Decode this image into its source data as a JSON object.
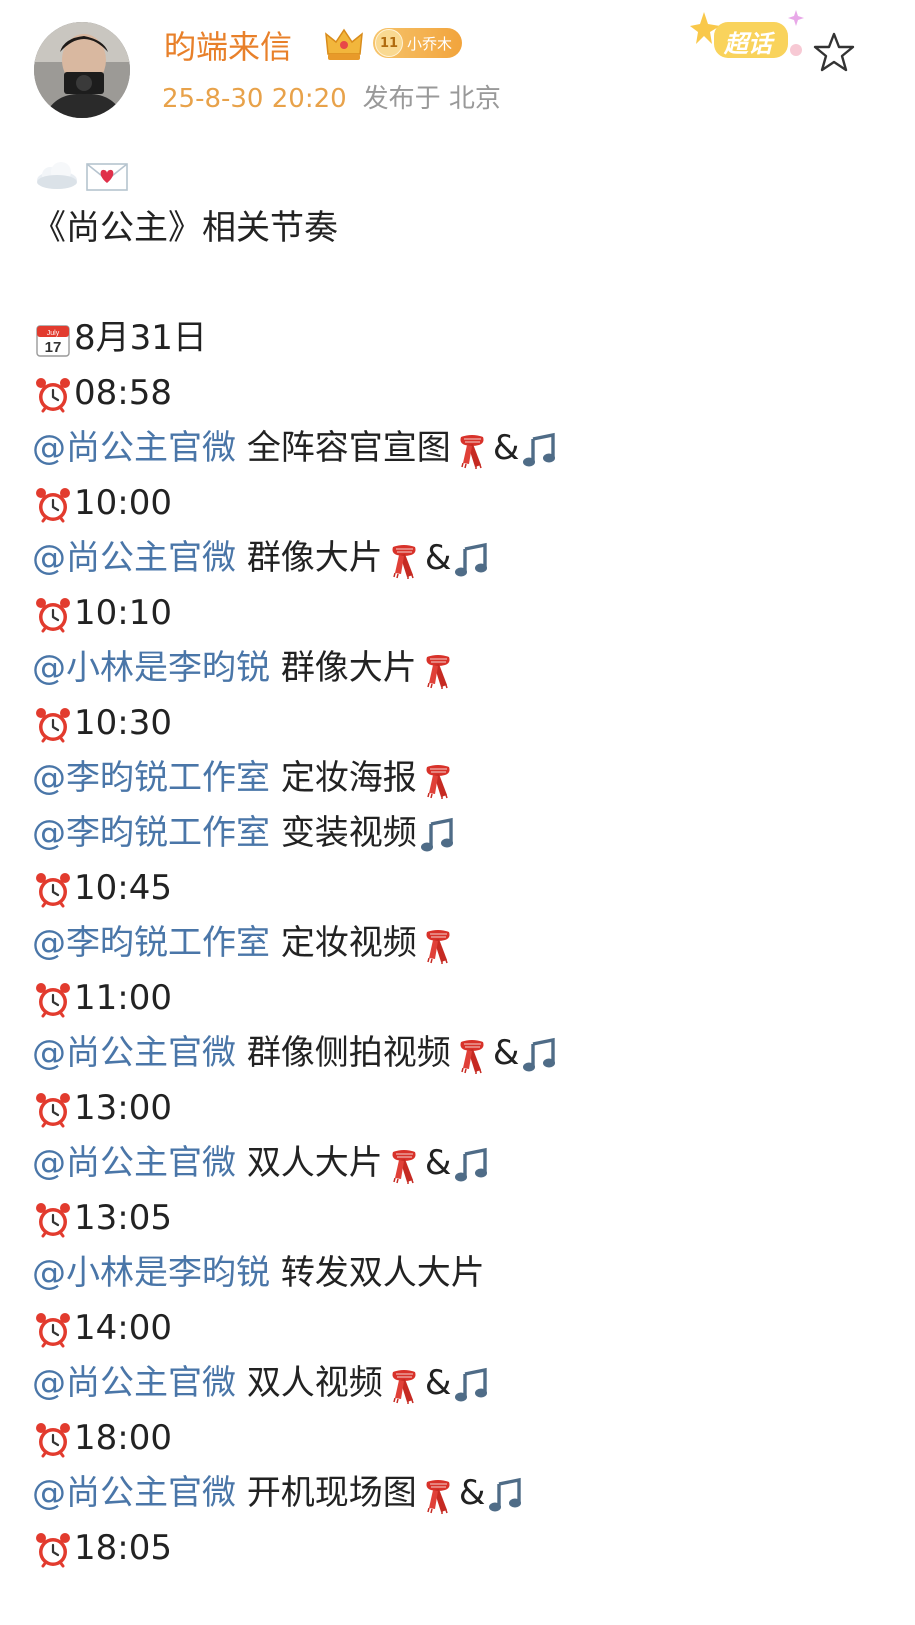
{
  "header": {
    "username": "昀端来信",
    "badge_level": "11",
    "badge_label": "小乔木",
    "post_date": "25-8-30 20:20",
    "post_location": "发布于 北京",
    "supertopic_label": "超话"
  },
  "post": {
    "emoji_line": [
      "cloud-emoji",
      "love-letter-emoji"
    ],
    "title": "《尚公主》相关节奏",
    "date_line": "8月31日",
    "schedule": [
      {
        "time": "08:58",
        "items": [
          {
            "mention": "@尚公主官微",
            "text": "全阵容官宣图",
            "icons": [
              "scarf",
              "amp",
              "music"
            ]
          }
        ]
      },
      {
        "time": "10:00",
        "items": [
          {
            "mention": "@尚公主官微",
            "text": "群像大片",
            "icons": [
              "scarf",
              "amp",
              "music"
            ]
          }
        ]
      },
      {
        "time": "10:10",
        "items": [
          {
            "mention": "@小林是李昀锐",
            "text": "群像大片",
            "icons": [
              "scarf"
            ]
          }
        ]
      },
      {
        "time": "10:30",
        "items": [
          {
            "mention": "@李昀锐工作室",
            "text": "定妆海报",
            "icons": [
              "scarf"
            ]
          },
          {
            "mention": "@李昀锐工作室",
            "text": "变装视频",
            "icons": [
              "music"
            ]
          }
        ]
      },
      {
        "time": "10:45",
        "items": [
          {
            "mention": "@李昀锐工作室",
            "text": "定妆视频",
            "icons": [
              "scarf"
            ]
          }
        ]
      },
      {
        "time": "11:00",
        "items": [
          {
            "mention": "@尚公主官微",
            "text": "群像侧拍视频",
            "icons": [
              "scarf",
              "amp",
              "music"
            ]
          }
        ]
      },
      {
        "time": "13:00",
        "items": [
          {
            "mention": "@尚公主官微",
            "text": "双人大片",
            "icons": [
              "scarf",
              "amp",
              "music"
            ]
          }
        ]
      },
      {
        "time": "13:05",
        "items": [
          {
            "mention": "@小林是李昀锐",
            "text": "转发双人大片",
            "icons": []
          }
        ]
      },
      {
        "time": "14:00",
        "items": [
          {
            "mention": "@尚公主官微",
            "text": "双人视频",
            "icons": [
              "scarf",
              "amp",
              "music"
            ]
          }
        ]
      },
      {
        "time": "18:00",
        "items": [
          {
            "mention": "@尚公主官微",
            "text": "开机现场图",
            "icons": [
              "scarf",
              "amp",
              "music"
            ]
          }
        ]
      },
      {
        "time": "18:05",
        "items": []
      }
    ],
    "amp_symbol": "&"
  },
  "colors": {
    "username": "#e8802a",
    "date": "#e8a24a",
    "mention": "#4a76a8",
    "text": "#222222",
    "muted": "#999999"
  }
}
